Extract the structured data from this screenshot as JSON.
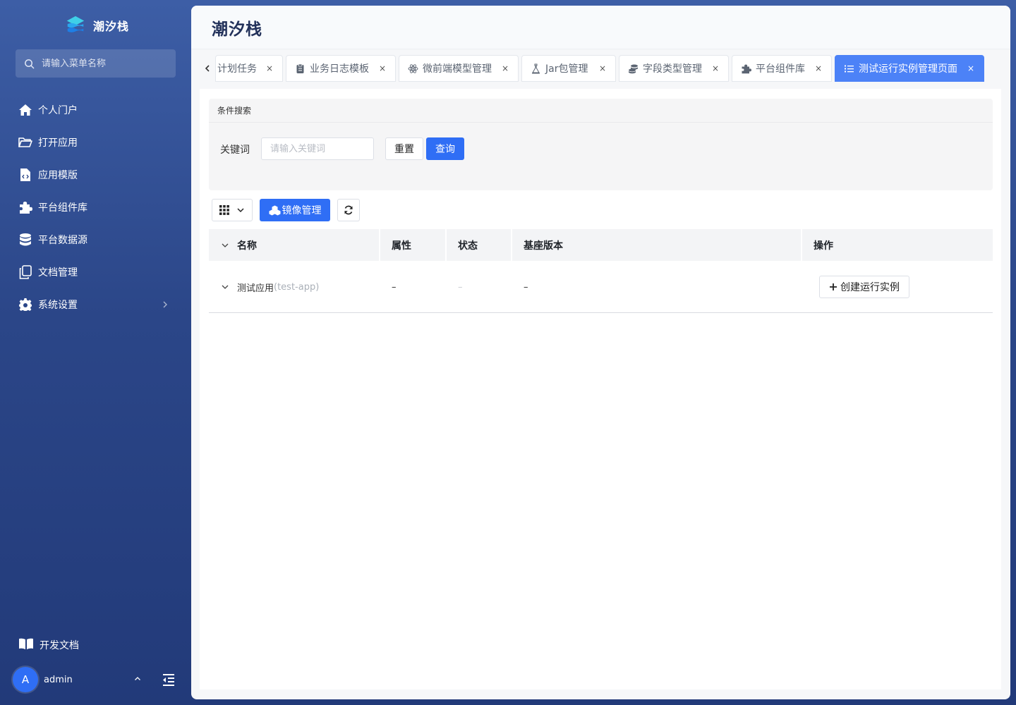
{
  "brand": {
    "name": "潮汐栈",
    "logo_icon": "tide-logo-icon"
  },
  "menu_search": {
    "placeholder": "请输入菜单名称"
  },
  "nav": {
    "items": [
      {
        "label": "个人门户",
        "icon": "home-icon"
      },
      {
        "label": "打开应用",
        "icon": "folder-open-icon"
      },
      {
        "label": "应用模版",
        "icon": "file-code-icon"
      },
      {
        "label": "平台组件库",
        "icon": "puzzle-icon"
      },
      {
        "label": "平台数据源",
        "icon": "database-icon"
      },
      {
        "label": "文档管理",
        "icon": "copy-icon"
      },
      {
        "label": "系统设置",
        "icon": "gear-icon"
      }
    ],
    "bottom_label": "开发文档"
  },
  "user": {
    "avatar_letter": "A",
    "name": "admin"
  },
  "header": {
    "title": "潮汐栈"
  },
  "tabs": [
    {
      "label": "计划任务",
      "close": "×"
    },
    {
      "label": "业务日志模板",
      "close": "×"
    },
    {
      "label": "微前端模型管理",
      "close": "×"
    },
    {
      "label": "Jar包管理",
      "close": "×"
    },
    {
      "label": "字段类型管理",
      "close": "×"
    },
    {
      "label": "平台组件库",
      "close": "×"
    },
    {
      "label": "测试运行实例管理页面",
      "close": "×",
      "active": true
    }
  ],
  "search_panel": {
    "title": "条件搜索",
    "keyword_label": "关键词",
    "keyword_placeholder": "请输入关键词",
    "keyword_value": "",
    "reset_label": "重置",
    "query_label": "查询"
  },
  "toolbar": {
    "mirror_label": "镜像管理"
  },
  "table": {
    "columns": [
      "名称",
      "属性",
      "状态",
      "基座版本",
      "操作"
    ],
    "rows": [
      {
        "name": "测试应用",
        "code": "(test-app)",
        "attr": "–",
        "status": "–",
        "base_version": "–",
        "action_label": "创建运行实例"
      }
    ]
  },
  "colors": {
    "primary": "#2f6ef5",
    "active_tab": "#4c82f7",
    "sidebar_top": "#3d5ea6",
    "sidebar_bottom": "#223a79"
  }
}
